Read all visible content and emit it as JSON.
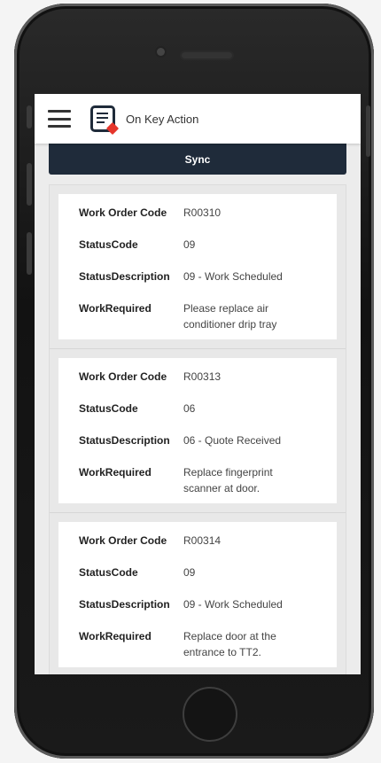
{
  "app": {
    "title": "On Key Action"
  },
  "toolbar": {
    "sync_label": "Sync"
  },
  "field_labels": {
    "code": "Work Order Code",
    "status_code": "StatusCode",
    "status_description": "StatusDescription",
    "work_required": "WorkRequired"
  },
  "work_orders": [
    {
      "code": "R00310",
      "status_code": "09",
      "status_description": "09 - Work Scheduled",
      "work_required": "Please replace air conditioner drip tray"
    },
    {
      "code": "R00313",
      "status_code": "06",
      "status_description": "06 - Quote Received",
      "work_required": "Replace fingerprint scanner at door."
    },
    {
      "code": "R00314",
      "status_code": "09",
      "status_description": "09 - Work Scheduled",
      "work_required": "Replace door at the entrance to TT2."
    }
  ],
  "colors": {
    "header_dark": "#1f2b3a",
    "logo_accent": "#e5352b",
    "background": "#ececec"
  },
  "icons": {
    "menu": "hamburger-icon",
    "logo": "document-icon"
  }
}
